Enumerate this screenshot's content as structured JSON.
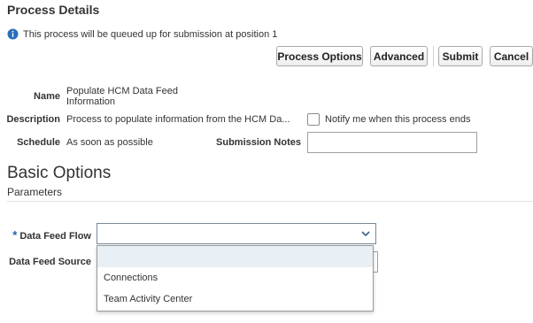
{
  "page": {
    "title": "Process Details",
    "info_message": "This process will be queued up for submission at position 1"
  },
  "toolbar": {
    "process_options_label": "Process Options",
    "advanced_label": "Advanced",
    "submit_label": "Submit",
    "cancel_label": "Cancel"
  },
  "details": {
    "name_label": "Name",
    "name_value_line1": "Populate HCM Data Feed",
    "name_value_line2": "Information",
    "description_label": "Description",
    "description_value": "Process to populate information from the HCM Da...",
    "notify_label": "Notify me when this process ends",
    "notify_checked": false,
    "schedule_label": "Schedule",
    "schedule_value": "As soon as possible",
    "submission_notes_label": "Submission Notes",
    "submission_notes_value": ""
  },
  "basic_options": {
    "heading": "Basic Options",
    "parameters_label": "Parameters",
    "required_marker": "*",
    "data_feed_flow_label": "Data Feed Flow",
    "data_feed_flow_value": "",
    "data_feed_source_label": "Data Feed Source",
    "dropdown_options": [
      "",
      "Connections",
      "Team Activity Center"
    ]
  },
  "colors": {
    "info_icon": "#2a6ebb",
    "required_marker": "#1f5da8",
    "selected_option_bg": "#e8eff5"
  },
  "icons": {
    "info": "info-icon",
    "dropdown_chevron": "chevron-down-icon"
  }
}
